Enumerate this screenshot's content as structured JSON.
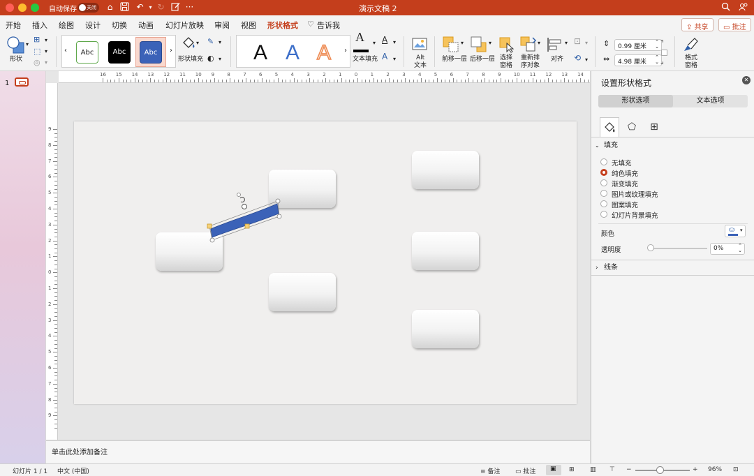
{
  "titlebar": {
    "autosave_label": "自动保存",
    "toggle_state": "关闭",
    "doc_title": "演示文稿 2"
  },
  "tabs": [
    {
      "label": "开始"
    },
    {
      "label": "插入"
    },
    {
      "label": "绘图"
    },
    {
      "label": "设计"
    },
    {
      "label": "切换"
    },
    {
      "label": "动画"
    },
    {
      "label": "幻灯片放映"
    },
    {
      "label": "审阅"
    },
    {
      "label": "视图"
    },
    {
      "label": "形状格式"
    },
    {
      "label": "告诉我"
    }
  ],
  "active_tab": "形状格式",
  "share_label": "共享",
  "comments_label": "批注",
  "ribbon": {
    "shape_label": "形状",
    "style_samples": [
      "Abc",
      "Abc",
      "Abc"
    ],
    "shape_fill_label": "形状填充",
    "wordart_sample": "A",
    "text_fill_label": "文本填充",
    "alt_text_label_1": "Alt",
    "alt_text_label_2": "文本",
    "bring_forward_label": "前移一层",
    "send_backward_label": "后移一层",
    "selection_pane_label_1": "选择",
    "selection_pane_label_2": "窗格",
    "reorder_label_1": "重新排",
    "reorder_label_2": "序对象",
    "align_label": "对齐",
    "height_value": "0.99 厘米",
    "width_value": "4.98 厘米",
    "format_pane_label_1": "格式",
    "format_pane_label_2": "窗格"
  },
  "ruler": {
    "top_ticks": [
      "16",
      "15",
      "14",
      "13",
      "12",
      "11",
      "10",
      "9",
      "8",
      "7",
      "6",
      "5",
      "4",
      "3",
      "2",
      "1",
      "0",
      "1",
      "2",
      "3",
      "4",
      "5",
      "6",
      "7",
      "8",
      "9",
      "10",
      "11",
      "12",
      "13",
      "14",
      "15",
      "16"
    ],
    "left_ticks": [
      "9",
      "8",
      "7",
      "6",
      "5",
      "4",
      "3",
      "2",
      "1",
      "0",
      "1",
      "2",
      "3",
      "4",
      "5",
      "6",
      "7",
      "8",
      "9"
    ]
  },
  "thumbnail": {
    "number": "1"
  },
  "notes_placeholder": "单击此处添加备注",
  "status": {
    "slide_info": "幻灯片 1 / 1",
    "language": "中文 (中国)",
    "notes_label": "备注",
    "comments_label": "批注",
    "zoom": "96%"
  },
  "panel": {
    "title": "设置形状格式",
    "tab_shape": "形状选项",
    "tab_text": "文本选项",
    "fill_section": "填充",
    "fill_options": [
      "无填充",
      "纯色填充",
      "渐变填充",
      "图片或纹理填充",
      "图案填充",
      "幻灯片背景填充"
    ],
    "selected_fill": "纯色填充",
    "color_label": "颜色",
    "transparency_label": "透明度",
    "transparency_value": "0%",
    "line_section": "线条"
  },
  "colors": {
    "accent": "#c43e1c",
    "selected_shape": "#3b62b8"
  }
}
